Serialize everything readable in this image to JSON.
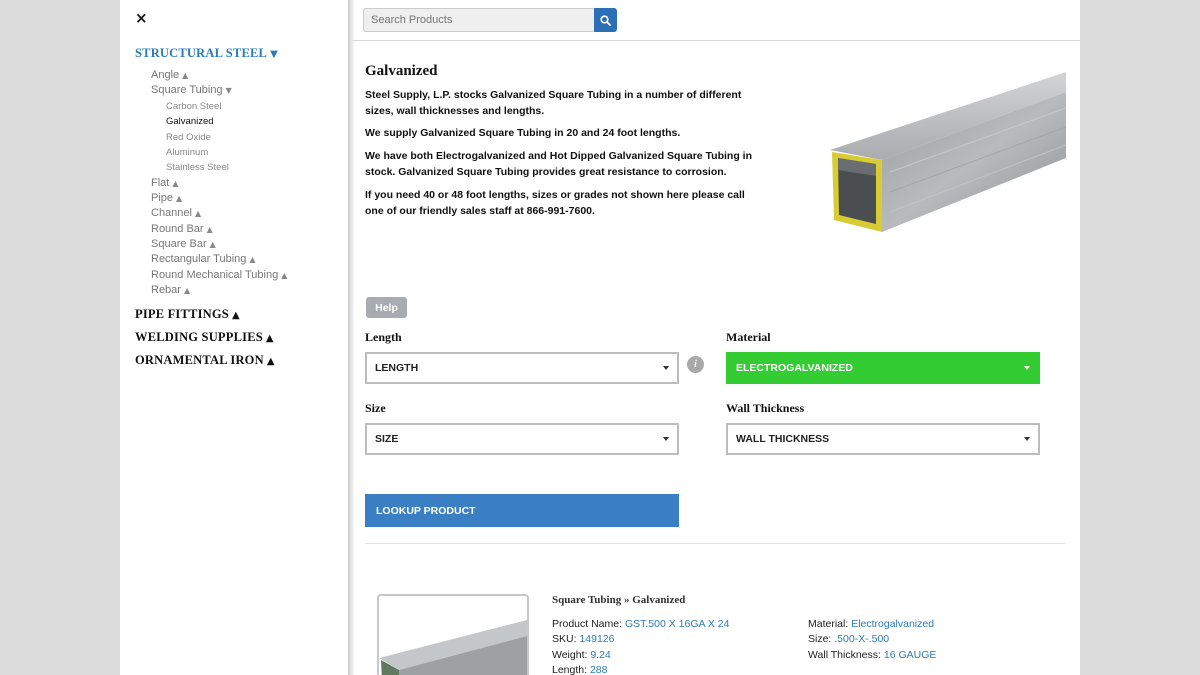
{
  "sidebar": {
    "close_label": "×",
    "top_items": [
      {
        "label": "STRUCTURAL STEEL",
        "arrow": "▼"
      },
      {
        "label": "PIPE FITTINGS",
        "arrow": "▲"
      },
      {
        "label": "WELDING SUPPLIES",
        "arrow": "▲"
      },
      {
        "label": "ORNAMENTAL IRON",
        "arrow": "▲"
      }
    ],
    "sub_items": [
      {
        "label": "Angle",
        "arrow": "▲"
      },
      {
        "label": "Square Tubing",
        "arrow": "▼"
      },
      {
        "label": "Flat",
        "arrow": "▲"
      },
      {
        "label": "Pipe",
        "arrow": "▲"
      },
      {
        "label": "Channel",
        "arrow": "▲"
      },
      {
        "label": "Round Bar",
        "arrow": "▲"
      },
      {
        "label": "Square Bar",
        "arrow": "▲"
      },
      {
        "label": "Rectangular Tubing",
        "arrow": "▲"
      },
      {
        "label": "Round Mechanical Tubing",
        "arrow": "▲"
      },
      {
        "label": "Rebar",
        "arrow": "▲"
      }
    ],
    "square_tubing_items": [
      "Carbon Steel",
      "Galvanized",
      "Red Oxide",
      "Aluminum",
      "Stainless Steel"
    ]
  },
  "search": {
    "placeholder": "Search Products",
    "icon": "search-icon"
  },
  "content": {
    "title": "Galvanized",
    "paragraphs": [
      "Steel Supply, L.P. stocks Galvanized Square Tubing in a number of different sizes, wall thicknesses and lengths.",
      "We supply Galvanized Square Tubing in 20 and 24 foot lengths.",
      "We have both Electrogalvanized and Hot Dipped Galvanized Square Tubing in stock. Galvanized Square Tubing provides great resistance to corrosion.",
      "If you need 40 or 48 foot lengths, sizes or grades not shown here please call one of our friendly sales staff at 866-991-7600."
    ]
  },
  "form": {
    "help_label": "Help",
    "length": {
      "label": "Length",
      "value": "LENGTH"
    },
    "material": {
      "label": "Material",
      "value": "ELECTROGALVANIZED"
    },
    "size": {
      "label": "Size",
      "value": "SIZE"
    },
    "wall": {
      "label": "Wall Thickness",
      "value": "WALL THICKNESS"
    },
    "info_icon": "i",
    "lookup_label": "LOOKUP PRODUCT"
  },
  "result": {
    "breadcrumb": "Square Tubing » Galvanized",
    "left": [
      {
        "key": "Product Name: ",
        "value": "GST.500 X 16GA X 24"
      },
      {
        "key": "SKU: ",
        "value": "149126"
      },
      {
        "key": "Weight: ",
        "value": "9.24"
      },
      {
        "key": "Length: ",
        "value": "288"
      }
    ],
    "right": [
      {
        "key": "Material: ",
        "value": "Electrogalvanized"
      },
      {
        "key": "Size: ",
        "value": ".500-X-.500"
      },
      {
        "key": "Wall Thickness: ",
        "value": "16 GAUGE"
      }
    ]
  },
  "colors": {
    "accent": "#2b7bb9",
    "green": "#33cc33",
    "button_blue": "#3a7fc3",
    "help_gray": "#a7acb3"
  }
}
